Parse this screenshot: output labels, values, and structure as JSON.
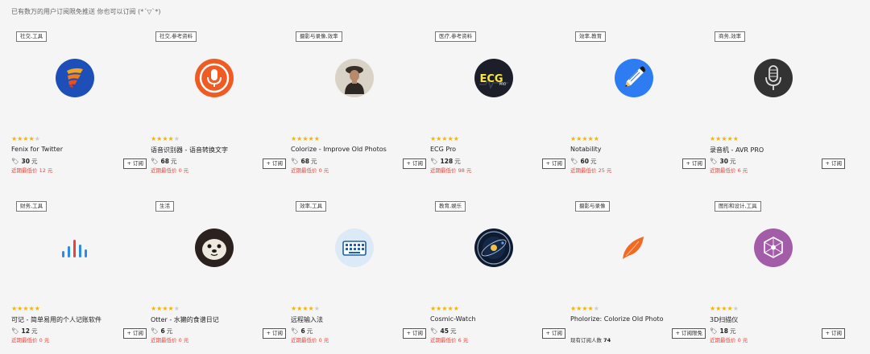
{
  "notice": "已有数万的用户订阅限免推送 你也可以订阅 (*´▽`*)",
  "cards": [
    {
      "tag": "社交,工具",
      "rating": 4,
      "name": "Fenix for Twitter",
      "price": "30",
      "unit": "元",
      "low_label": "近期最低价",
      "low_value": "12 元",
      "button": "+ 订阅",
      "icon": "fenix-logo-icon"
    },
    {
      "tag": "社交,参考资料",
      "rating": 4,
      "name": "语音识别器 - 语音转换文字",
      "price": "68",
      "unit": "元",
      "low_label": "近期最低价",
      "low_value": "0 元",
      "button": "+ 订阅",
      "icon": "microphone-app-icon"
    },
    {
      "tag": "摄影与录像,效率",
      "rating": 5,
      "name": "Colorize - Improve Old Photos",
      "price": "68",
      "unit": "元",
      "low_label": "近期最低价",
      "low_value": "0 元",
      "button": "+ 订阅",
      "icon": "old-photo-portrait-icon"
    },
    {
      "tag": "医疗,参考资料",
      "rating": 5,
      "name": "ECG Pro",
      "price": "128",
      "unit": "元",
      "low_label": "近期最低价",
      "low_value": "98 元",
      "button": "+ 订阅",
      "icon": "ecg-pro-icon",
      "icon_text": "ECG",
      "icon_sub": "PRO"
    },
    {
      "tag": "效率,教育",
      "rating": 5,
      "name": "Notability",
      "price": "60",
      "unit": "元",
      "low_label": "近期最低价",
      "low_value": "25 元",
      "button": "+ 订阅",
      "icon": "pencil-notebook-icon"
    },
    {
      "tag": "商务,效率",
      "rating": 5,
      "name": "录音机 - AVR PRO",
      "price": "30",
      "unit": "元",
      "low_label": "近期最低价",
      "low_value": "6 元",
      "button": "+ 订阅",
      "icon": "studio-microphone-icon"
    },
    {
      "tag": "财务,工具",
      "rating": 5,
      "name": "可记 - 简单易用的个人记账软件",
      "price": "12",
      "unit": "元",
      "low_label": "近期最低价",
      "low_value": "0 元",
      "button": "+ 订阅",
      "icon": "bar-chart-logo-icon"
    },
    {
      "tag": "生活",
      "rating": 4,
      "name": "Otter - 水獭的食谱日记",
      "price": "6",
      "unit": "元",
      "low_label": "近期最低价",
      "low_value": "0 元",
      "button": "+ 订阅",
      "icon": "otter-face-icon"
    },
    {
      "tag": "效率,工具",
      "rating": 4,
      "name": "远程输入法",
      "price": "6",
      "unit": "元",
      "low_label": "近期最低价",
      "low_value": "0 元",
      "button": "+ 订阅",
      "icon": "keyboard-icon"
    },
    {
      "tag": "教育,娱乐",
      "rating": 5,
      "name": "Cosmic-Watch",
      "price": "45",
      "unit": "元",
      "low_label": "近期最低价",
      "low_value": "6 元",
      "button": "+ 订阅",
      "icon": "cosmic-watch-icon"
    },
    {
      "tag": "摄影与录像",
      "rating": 4,
      "name": "Pholorize: Colorize Old Photo",
      "subs_label": "现有订阅人数",
      "subs_value": "74",
      "button": "+ 订阅限免",
      "icon": "orange-leaf-icon"
    },
    {
      "tag": "图形和设计,工具",
      "rating": 4,
      "name": "3D扫描仪",
      "price": "18",
      "unit": "元",
      "low_label": "近期最低价",
      "low_value": "0 元",
      "button": "+ 订阅",
      "icon": "scanner-cube-icon"
    }
  ],
  "colors": {
    "star": "#f5b400",
    "low_price": "#e2483d",
    "background": "#f5f5f5"
  }
}
